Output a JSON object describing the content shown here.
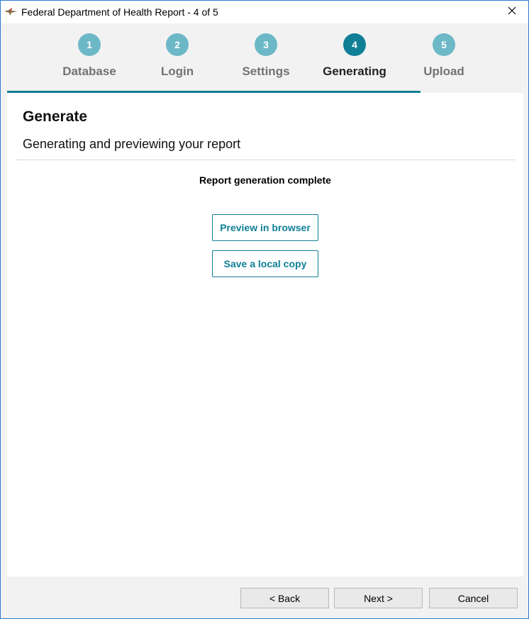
{
  "window": {
    "title": "Federal Department of Health Report - 4 of 5",
    "app_icon": "bird-icon",
    "close_icon": "close-icon"
  },
  "steps": [
    {
      "number": "1",
      "label": "Database",
      "state": "done"
    },
    {
      "number": "2",
      "label": "Login",
      "state": "done"
    },
    {
      "number": "3",
      "label": "Settings",
      "state": "done"
    },
    {
      "number": "4",
      "label": "Generating",
      "state": "active"
    },
    {
      "number": "5",
      "label": "Upload",
      "state": "pending"
    }
  ],
  "page": {
    "heading": "Generate",
    "subheading": "Generating and previewing your report",
    "status": "Report generation complete",
    "preview_button": "Preview in browser",
    "save_button": "Save a local copy"
  },
  "footer": {
    "back": "< Back",
    "next": "Next >",
    "cancel": "Cancel"
  },
  "colors": {
    "accent": "#0f7f96",
    "step_inactive": "#6cb8c7",
    "window_border": "#2b7bd0"
  }
}
